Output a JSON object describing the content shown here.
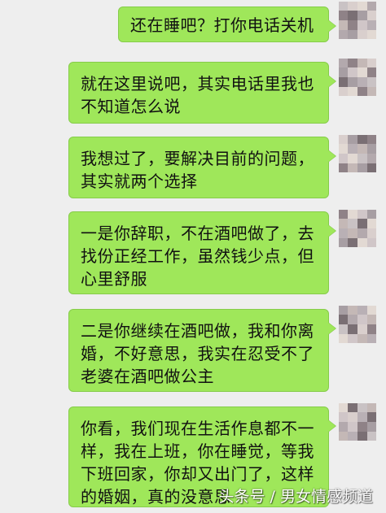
{
  "messages": [
    {
      "lines": [
        "还在睡吧？打你电话关机"
      ]
    },
    {
      "lines": [
        "就在这里说吧，其实电话里我也",
        "不知道怎么说"
      ]
    },
    {
      "lines": [
        "我想过了，要解决目前的问题，",
        "其实就两个选择"
      ]
    },
    {
      "lines": [
        "一是你辞职，不在酒吧做了，去",
        "找份正经工作，虽然钱少点，但",
        "心里舒服"
      ]
    },
    {
      "lines": [
        "二是你继续在酒吧做，我和你离",
        "婚，不好意思，我实在忍受不了",
        "老婆在酒吧做公主"
      ]
    },
    {
      "lines": [
        "你看，我们现在生活作息都不一",
        "样，我在上班，你在睡觉，等我",
        "下班回家，你却又出门了，这样",
        "的婚姻，真的没意思"
      ]
    }
  ],
  "watermark": "头条号 / 男女情感频道",
  "colors": {
    "background": "#eeeeee",
    "bubble": "#9fe75a",
    "bubble_border": "#86cc4a"
  },
  "avatar_icon": "blurred-avatar-icon"
}
